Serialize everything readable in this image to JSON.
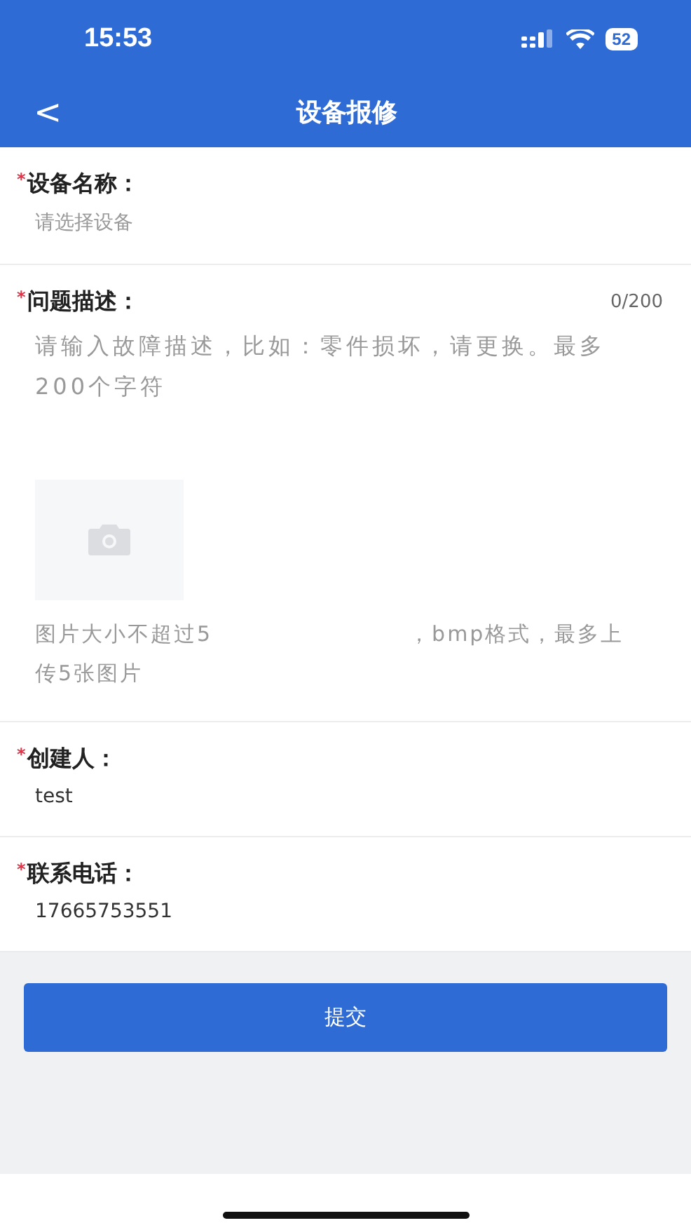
{
  "status_bar": {
    "time": "15:53",
    "battery": "52"
  },
  "nav": {
    "back": "<",
    "title": "设备报修"
  },
  "fields": [
    {
      "kind": "select",
      "required_mark": "*",
      "label": "设备名称：",
      "placeholder": "请选择设备"
    },
    {
      "kind": "textarea",
      "required_mark": "*",
      "label": "问题描述：",
      "counter": "0/200",
      "placeholder": "请输入故障描述，比如：零件损坏，请更换。最多200个字符",
      "upload": {
        "hint": [
          "图片大小不超过5",
          "，bmp格式，最多上传5张图片"
        ]
      }
    },
    {
      "kind": "text",
      "required_mark": "*",
      "label": "创建人：",
      "value": "test"
    },
    {
      "kind": "text",
      "required_mark": "*",
      "label": "联系电话：",
      "value": "17665753551"
    }
  ],
  "submit": "提交"
}
